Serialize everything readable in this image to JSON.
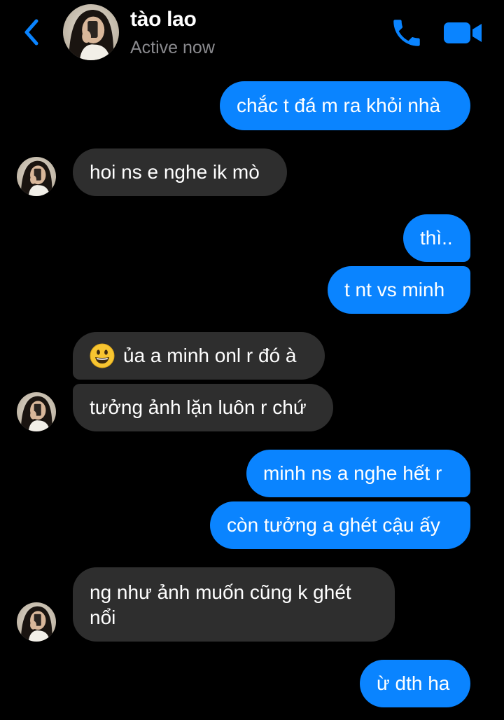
{
  "header": {
    "contact_name": "tào lao",
    "status": "Active now",
    "back_icon": "chevron-left-icon",
    "call_icon": "phone-icon",
    "video_icon": "video-camera-icon",
    "accent_color": "#0a84ff"
  },
  "messages": [
    {
      "sender": "me",
      "text": "chắc t đá m ra khỏi nhà"
    },
    {
      "sender": "them",
      "text": "hoi ns e nghe ik mò"
    },
    {
      "sender": "me",
      "text": "thì.."
    },
    {
      "sender": "me",
      "text": "t nt vs minh"
    },
    {
      "sender": "them",
      "text": "ủa a minh onl r đó à",
      "emoji": "grinning-face"
    },
    {
      "sender": "them",
      "text": "tưởng ảnh lặn luôn r chứ"
    },
    {
      "sender": "me",
      "text": "minh ns a nghe hết r"
    },
    {
      "sender": "me",
      "text": "còn tưởng a ghét cậu ấy"
    },
    {
      "sender": "them",
      "text": "ng như ảnh muốn cũng k ghét nổi"
    },
    {
      "sender": "me",
      "text": "ừ dth ha"
    }
  ],
  "colors": {
    "outgoing_bubble": "#0a84ff",
    "incoming_bubble": "#2e2e2e",
    "background": "#000000",
    "status_text": "#8a8a8e"
  }
}
